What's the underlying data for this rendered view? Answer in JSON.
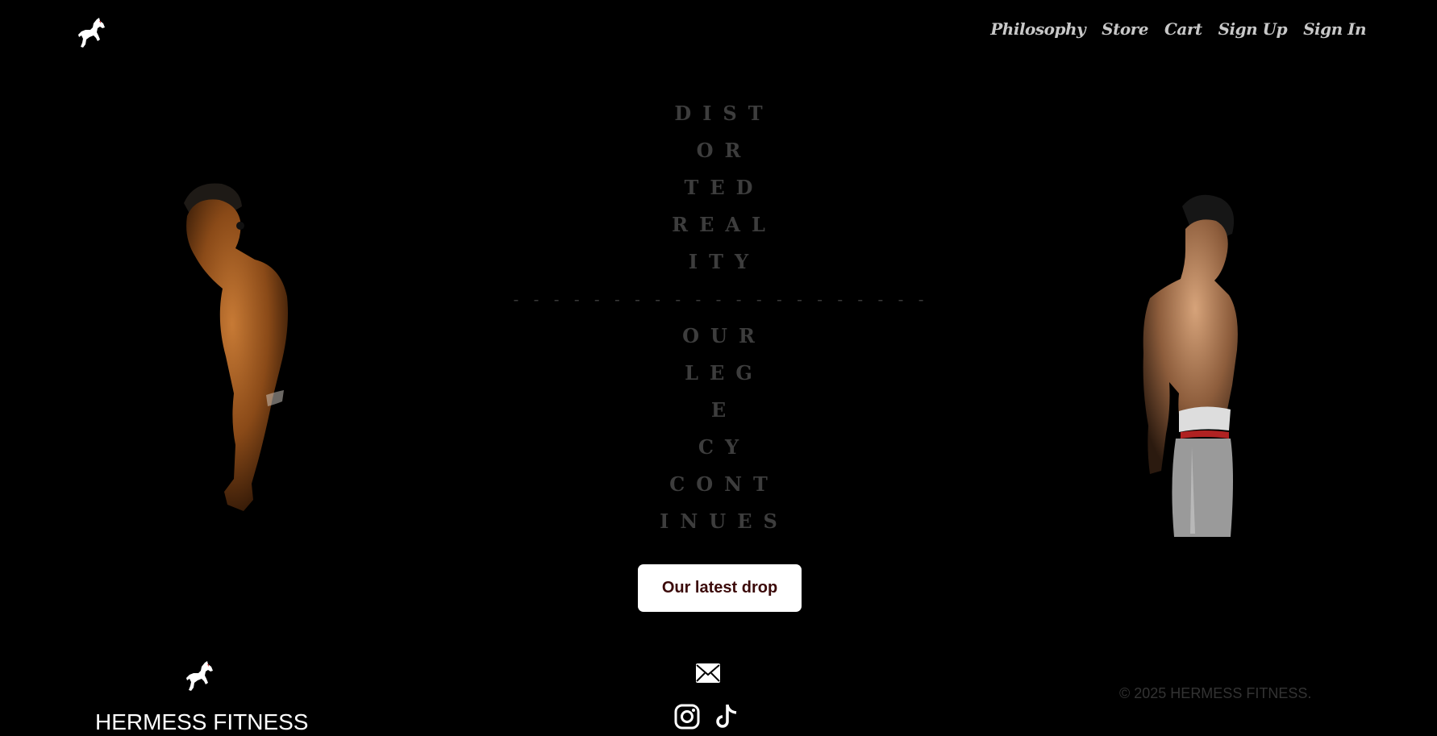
{
  "nav": {
    "items": [
      "Philosophy",
      "Store",
      "Cart",
      "Sign Up",
      "Sign In"
    ]
  },
  "hero": {
    "lines_top": [
      "DIST",
      "OR",
      "TED",
      "REAL",
      "ITY"
    ],
    "separator": "- - - - - - - - - - - - - - - - - - - - -",
    "lines_bottom": [
      "OUR",
      "LEG",
      "E",
      "CY",
      "CONT",
      "INUES"
    ]
  },
  "cta": {
    "label": "Our latest drop"
  },
  "footer": {
    "brand": "HERMESS FITNESS",
    "copyright": "© 2025 HERMESS FITNESS."
  },
  "icons": {
    "logo": "horse-logo-icon",
    "mail": "mail-icon",
    "instagram": "instagram-icon",
    "tiktok": "tiktok-icon"
  },
  "colors": {
    "background": "#000000",
    "nav_text": "#c8c8c8",
    "hero_text": "#3d3d3d",
    "cta_bg": "#ffffff",
    "cta_text": "#3b0a0a",
    "copyright": "#333333"
  }
}
